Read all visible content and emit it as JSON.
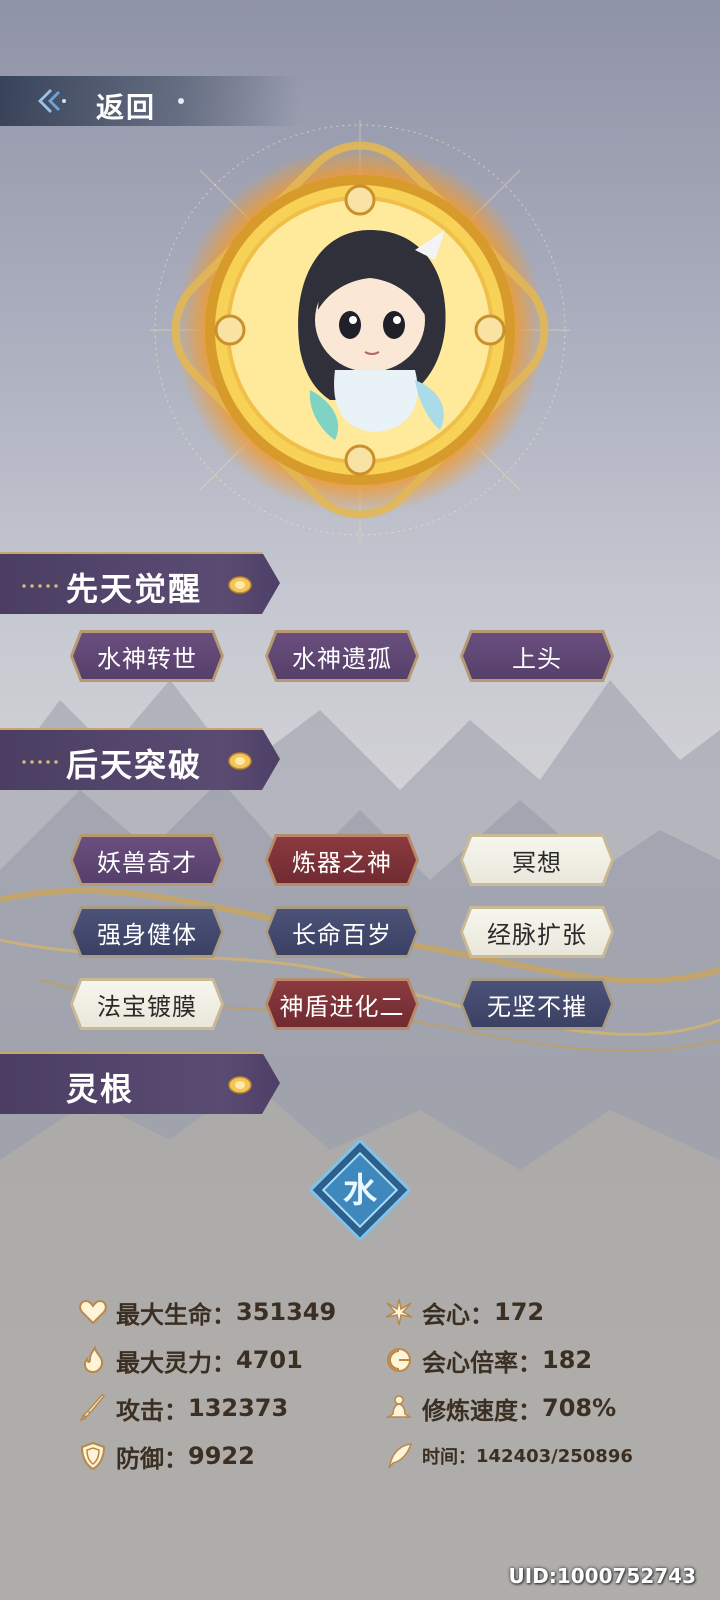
{
  "header": {
    "back_label": "返回"
  },
  "sections": {
    "innate": "先天觉醒",
    "acquired": "后天突破",
    "spirit_root": "灵根"
  },
  "innate_tags": [
    {
      "label": "水神转世",
      "style": "purple"
    },
    {
      "label": "水神遗孤",
      "style": "purple"
    },
    {
      "label": "上头",
      "style": "purple"
    }
  ],
  "acquired_tags": [
    {
      "label": "妖兽奇才",
      "style": "purple"
    },
    {
      "label": "炼器之神",
      "style": "red"
    },
    {
      "label": "冥想",
      "style": "white"
    },
    {
      "label": "强身健体",
      "style": "navy"
    },
    {
      "label": "长命百岁",
      "style": "navy"
    },
    {
      "label": "经脉扩张",
      "style": "white"
    },
    {
      "label": "法宝镀膜",
      "style": "white"
    },
    {
      "label": "神盾进化二",
      "style": "red"
    },
    {
      "label": "无坚不摧",
      "style": "navy"
    }
  ],
  "spirit_root": {
    "glyph": "水",
    "icon": "water-root-icon"
  },
  "stats": {
    "max_hp": {
      "label": "最大生命：",
      "value": "351349",
      "icon": "heart-icon"
    },
    "max_sp": {
      "label": "最大灵力：",
      "value": "4701",
      "icon": "flame-icon"
    },
    "attack": {
      "label": "攻击：",
      "value": "132373",
      "icon": "sword-icon"
    },
    "defense": {
      "label": "防御：",
      "value": "9922",
      "icon": "shield-icon"
    },
    "crit": {
      "label": "会心：",
      "value": "172",
      "icon": "burst-icon"
    },
    "crit_rate": {
      "label": "会心倍率：",
      "value": "182",
      "icon": "crit-multiplier-icon"
    },
    "cultivation_speed": {
      "label": "修炼速度：",
      "value": "708%",
      "icon": "meditation-icon"
    },
    "time": {
      "label": "时间：",
      "value": "142403/250896",
      "icon": "quill-icon"
    }
  },
  "uid": "UID:1000752743",
  "colors": {
    "accent_gold": "#c8a56a",
    "section_bg": "#4b3e62",
    "stat_text": "#3a2f22"
  }
}
